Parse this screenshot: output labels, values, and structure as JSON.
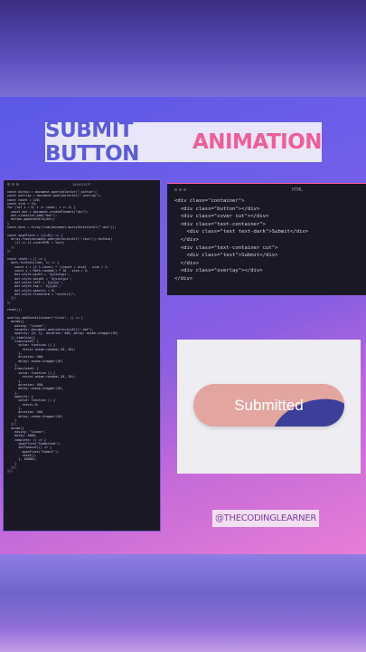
{
  "title": {
    "word1": "SUBMIT BUTTON",
    "word2": "ANIMATION"
  },
  "js_window": {
    "tab": "JAVASCRIPT",
    "code": "const button = document.querySelector(\".button\");\nconst overlay = document.querySelector(\".overlay\");\nconst count = 120;\nconst size = 10;\nfor (let i = 0; i <= count; i += 1) {\n  const dot = document.createElement(\"div\");\n  dot.classList.add(\"dot\");\n  button.appendChild(dot);\n}\nconst dots = Array.from(document.querySelectorAll(\".dot\"));\n\nconst spanFlare = ({i=0}) => {\n  Array.from(document.querySelectorAll(\".text\")).forEach(\n    (i) => (i.innerHTML = text)\n  );\n};\n\nconst reset = () => {\n  dots.forEach((dot, i) => {\n    const x = (i % count) * ((count + size) - size / 2;\n    const y = Math.random() * 10 - size / 2;\n    dot.style.width = `${size}px`;\n    dot.style.height = `${size}px`;\n    dot.style.left = `${x}px`;\n    dot.style.top = `${y}px`;\n    dot.style.opacity = 0;\n    dot.style.transform = \"scale(1)\";\n  });\n};\n\nreset();\n\noverlay.addEventListener(\"click\", () => {\n  anime({\n    easing: \"linear\",\n    targets: document.querySelectorAll(\".dot\"),\n    opacity: [0, 1], duration: 400, delay: anime.stagger(10)\n  }).timeline({\n    translateY: {\n      value: function () {\n        return anime.random(-20, 20);\n      },\n      duration: 400,\n      delay: anime.stagger(10)\n    },\n    translateX: {\n      value: function () {\n        return anime.random(-20, 20);\n      },\n      duration: 400,\n      delay: anime.stagger(10)\n    },\n    opacity: {\n      value: function () {\n        return 0;\n      },\n      duration: 400,\n      delay: anime.stagger(10)\n    }\n  });\n  anime({\n    easing: \"linear\",\n    delay: 4000,\n    complete: () => {\n      spanFlare(\"Submitted\");\n      setTimeout(() => {\n        spanFlare(\"Submit\");\n        reset();\n      }, 10000);\n    }\n  });\n});"
  },
  "html_window": {
    "tab": "HTML",
    "code": "<div class=\"container\">\n  <div class=\"button\"></div>\n  <div class=\"cover cut\"></div>\n  <div class=\"text-container\">\n    <div class=\"text text-dark\">Submit</div>\n  </div>\n  <div class=\"text-container cut\">\n    <div class=\"text\">Submit</div>\n  </div>\n  <div class=\"overlay\"></div>\n</div>"
  },
  "preview": {
    "button_label": "Submitted"
  },
  "handle": "@THECODINGLEARNER",
  "colors": {
    "accent_blue": "#5b5bd9",
    "accent_pink": "#ef5d9a",
    "button_peach": "#e2a59f",
    "button_fill": "#3b3f9a"
  }
}
